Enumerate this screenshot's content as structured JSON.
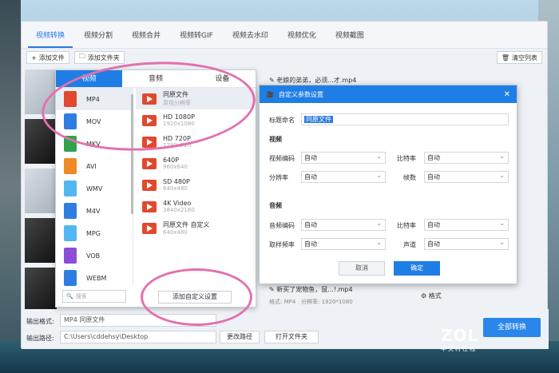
{
  "tabs": [
    {
      "label": "视频转换",
      "active": true
    },
    {
      "label": "视频分割"
    },
    {
      "label": "视频合并"
    },
    {
      "label": "视频转GIF"
    },
    {
      "label": "视频去水印"
    },
    {
      "label": "视频优化"
    },
    {
      "label": "视频截图"
    }
  ],
  "toolbar": {
    "add_file": "添加文件",
    "add_folder": "添加文件夹",
    "clear_list": "清空列表"
  },
  "files": [
    {
      "name": "老娘的弟弟，必须...才.mp4"
    },
    {
      "name": "新买了宠物鱼，鼠...!.mp4",
      "format_label": "格式:",
      "format": "MP4",
      "resolution_label": "分辨率:",
      "resolution": "1920*1080",
      "settings": "格式"
    }
  ],
  "format_popup": {
    "tabs": [
      "视频",
      "音频",
      "设备"
    ],
    "categories": [
      {
        "label": "MP4",
        "color": "#e0492e",
        "active": true
      },
      {
        "label": "MOV",
        "color": "#2f7de1"
      },
      {
        "label": "MKV",
        "color": "#2fa34e"
      },
      {
        "label": "AVI",
        "color": "#f08a24"
      },
      {
        "label": "WMV",
        "color": "#52b7f0"
      },
      {
        "label": "M4V",
        "color": "#2f7de1"
      },
      {
        "label": "MPG",
        "color": "#52b7f0"
      },
      {
        "label": "VOB",
        "color": "#8a4fd6"
      },
      {
        "label": "WEBM",
        "color": "#2f7de1"
      }
    ],
    "presets": [
      {
        "name": "同原文件",
        "desc": "原视分辨率",
        "active": true
      },
      {
        "name": "HD 1080P",
        "desc": "1920x1080"
      },
      {
        "name": "HD 720P",
        "desc": "1280x720"
      },
      {
        "name": "640P",
        "desc": "960x640"
      },
      {
        "name": "SD 480P",
        "desc": "640x480"
      },
      {
        "name": "4K Video",
        "desc": "3840x2160"
      },
      {
        "name": "同原文件 自定义",
        "desc": "640x480"
      }
    ],
    "search_placeholder": "搜索",
    "custom_button": "添加自定义设置"
  },
  "dialog": {
    "title": "自定义参数设置",
    "name_label": "标题命名",
    "name_value": "同原文件",
    "video_section": "视频",
    "video_codec_label": "视频编码",
    "video_codec": "自动",
    "bitrate_label": "比特率",
    "bitrate": "自动",
    "resolution_label": "分辨率",
    "resolution": "自动",
    "framerate_label": "帧数",
    "framerate": "自动",
    "audio_section": "音频",
    "audio_codec_label": "音频编码",
    "audio_codec": "自动",
    "audio_bitrate_label": "比特率",
    "audio_bitrate": "自动",
    "sample_rate_label": "取样频率",
    "sample_rate": "自动",
    "channel_label": "声道",
    "channel": "自动",
    "cancel": "取消",
    "ok": "确定"
  },
  "bottom": {
    "output_format_label": "输出格式:",
    "output_format": "MP4  同原文件",
    "output_path_label": "输出路径:",
    "output_path": "C:\\Users\\cddehsy\\Desktop",
    "change_path": "更改路径",
    "open_folder": "打开文件夹",
    "convert_all": "全部转换"
  },
  "watermark": {
    "brand": "ZOL",
    "sub": "中关村在线"
  },
  "colors": {
    "accent": "#1f7ee6",
    "highlight_circle": "#e46fae"
  }
}
